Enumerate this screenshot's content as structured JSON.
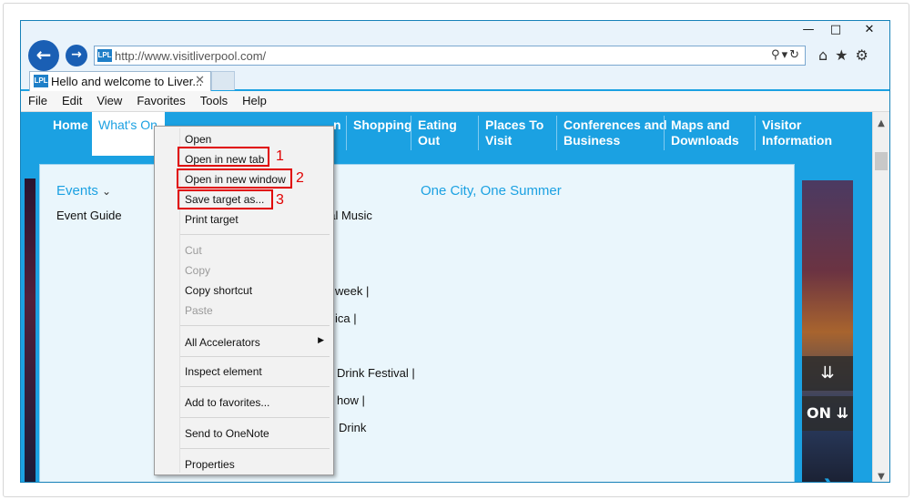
{
  "browser": {
    "url": "http://www.visitliverpool.com/",
    "site_badge": "LPL",
    "tab_title": "Hello and welcome to Liver...",
    "tab_close": "✕",
    "menu": [
      "File",
      "Edit",
      "View",
      "Favorites",
      "Tools",
      "Help"
    ]
  },
  "nav": {
    "home": "Home",
    "whats_on": "What's On",
    "partial_1": "n",
    "shopping": "Shopping",
    "eating_1": "Eating",
    "eating_2": "Out",
    "places_1": "Places To",
    "places_2": "Visit",
    "conf_1": "Conferences and",
    "conf_2": "Business",
    "maps_1": "Maps and",
    "maps_2": "Downloads",
    "visitor_1": "Visitor",
    "visitor_2": "Information"
  },
  "content": {
    "events": "Events",
    "event_guide": "Event Guide",
    "heading": "One City, One Summer",
    "lines": [
      "nal Music",
      "week  |",
      "ica  |",
      "Drink Festival  |",
      "how  |",
      "Drink"
    ],
    "banner_text": "ON"
  },
  "context_menu": {
    "open": "Open",
    "open_new_tab": "Open in new tab",
    "open_new_window": "Open in new window",
    "save_target": "Save target as...",
    "print_target": "Print target",
    "cut": "Cut",
    "copy": "Copy",
    "copy_shortcut": "Copy shortcut",
    "paste": "Paste",
    "all_accelerators": "All Accelerators",
    "inspect_element": "Inspect element",
    "add_to_favorites": "Add to favorites...",
    "send_to_onenote": "Send to OneNote",
    "properties": "Properties"
  },
  "annotations": [
    "1",
    "2",
    "3"
  ],
  "colors": {
    "brand": "#1ba1e2",
    "highlight": "#e00000"
  }
}
